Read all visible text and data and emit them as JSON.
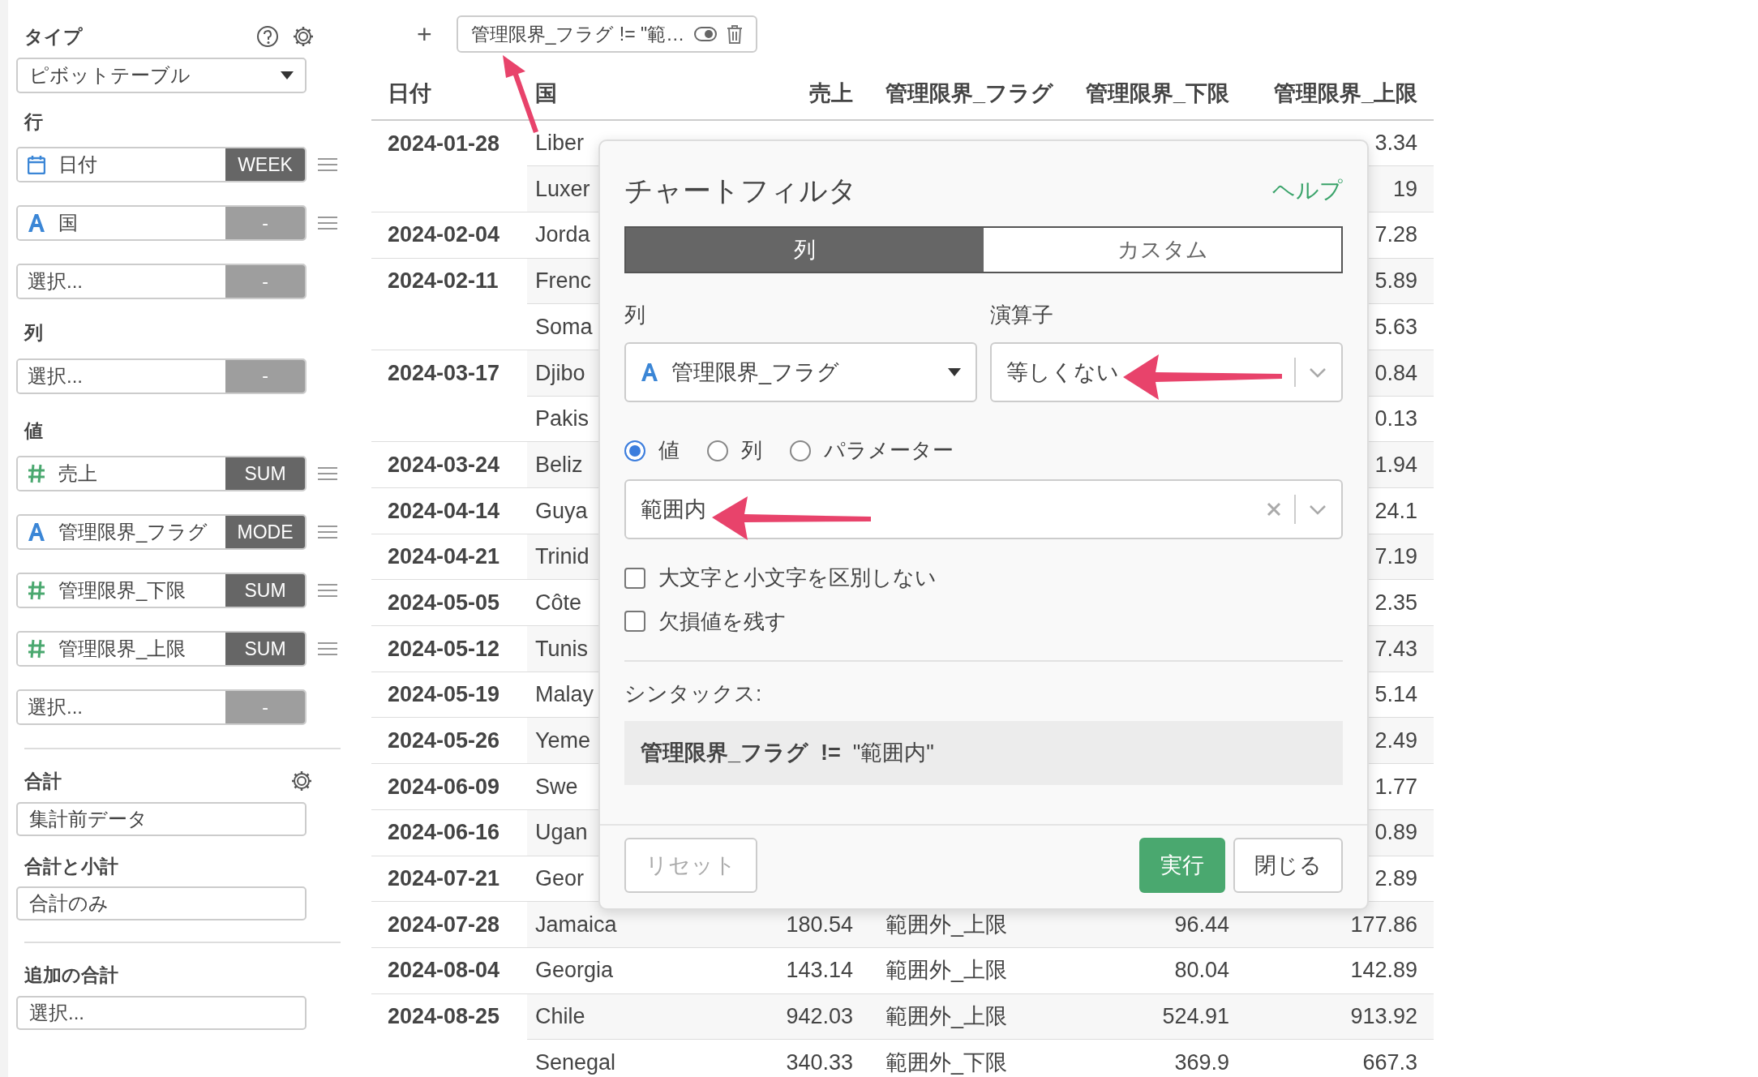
{
  "sidebar": {
    "type_label": "タイプ",
    "type_select": "ピボットテーブル",
    "sections": [
      {
        "label": "行",
        "fields": [
          {
            "kind": "date",
            "name": "日付",
            "agg": "WEEK",
            "agg_set": true,
            "draggable": true
          },
          {
            "kind": "text",
            "name": "国",
            "agg": "-",
            "agg_set": false,
            "draggable": true
          },
          {
            "kind": "empty",
            "placeholder": "選択...",
            "agg": "-",
            "agg_set": false,
            "draggable": false
          }
        ]
      },
      {
        "label": "列",
        "fields": [
          {
            "kind": "empty",
            "placeholder": "選択...",
            "agg": "-",
            "agg_set": false,
            "draggable": false
          }
        ]
      },
      {
        "label": "値",
        "fields": [
          {
            "kind": "number",
            "name": "売上",
            "agg": "SUM",
            "agg_set": true,
            "draggable": true
          },
          {
            "kind": "text",
            "name": "管理限界_フラグ",
            "agg": "MODE",
            "agg_set": true,
            "draggable": true
          },
          {
            "kind": "number",
            "name": "管理限界_下限",
            "agg": "SUM",
            "agg_set": true,
            "draggable": true
          },
          {
            "kind": "number",
            "name": "管理限界_上限",
            "agg": "SUM",
            "agg_set": true,
            "draggable": true
          },
          {
            "kind": "empty",
            "placeholder": "選択...",
            "agg": "-",
            "agg_set": false,
            "draggable": false
          }
        ]
      }
    ],
    "total": {
      "label": "合計",
      "value": "集計前データ"
    },
    "subtotal": {
      "label": "合計と小計",
      "value": "合計のみ"
    },
    "extra": {
      "label": "追加の合計",
      "placeholder": "選択..."
    }
  },
  "add_filter": "+",
  "filter_chip": {
    "text": "管理限界_フラグ != \"範…",
    "enabled": true
  },
  "table": {
    "columns": [
      "日付",
      "国",
      "売上",
      "管理限界_フラグ",
      "管理限界_下限",
      "管理限界_上限"
    ],
    "rows": [
      {
        "date": "2024-01-28",
        "country": "Liber",
        "upper": "3.34"
      },
      {
        "country": "Luxer",
        "upper": "19"
      },
      {
        "date": "2024-02-04",
        "country": "Jorda",
        "upper": "7.28"
      },
      {
        "date": "2024-02-11",
        "country": "Frenc",
        "upper": "5.89"
      },
      {
        "country": "Soma",
        "upper": "5.63"
      },
      {
        "date": "2024-03-17",
        "country": "Djibo",
        "upper": "0.84"
      },
      {
        "country": "Pakis",
        "upper": "0.13"
      },
      {
        "date": "2024-03-24",
        "country": "Beliz",
        "upper": "1.94"
      },
      {
        "date": "2024-04-14",
        "country": "Guya",
        "upper": "24.1"
      },
      {
        "date": "2024-04-21",
        "country": "Trinid",
        "upper": "7.19"
      },
      {
        "date": "2024-05-05",
        "country": "Côte",
        "upper": "2.35"
      },
      {
        "date": "2024-05-12",
        "country": "Tunis",
        "upper": "7.43"
      },
      {
        "date": "2024-05-19",
        "country": "Malay",
        "upper": "5.14"
      },
      {
        "date": "2024-05-26",
        "country": "Yeme",
        "upper": "2.49"
      },
      {
        "date": "2024-06-09",
        "country": "Swe",
        "upper": "1.77"
      },
      {
        "date": "2024-06-16",
        "country": "Ugan",
        "upper": "0.89"
      },
      {
        "date": "2024-07-21",
        "country": "Geor",
        "upper": "2.89"
      },
      {
        "date": "2024-07-28",
        "country": "Jamaica",
        "sales": "180.54",
        "flag": "範囲外_上限",
        "lower": "96.44",
        "upper": "177.86"
      },
      {
        "date": "2024-08-04",
        "country": "Georgia",
        "sales": "143.14",
        "flag": "範囲外_上限",
        "lower": "80.04",
        "upper": "142.89"
      },
      {
        "date": "2024-08-25",
        "country": "Chile",
        "sales": "942.03",
        "flag": "範囲外_上限",
        "lower": "524.91",
        "upper": "913.92"
      },
      {
        "country": "Senegal",
        "sales": "340.33",
        "flag": "範囲外_下限",
        "lower": "369.9",
        "upper": "667.3"
      }
    ]
  },
  "dialog": {
    "title": "チャートフィルタ",
    "help": "ヘルプ",
    "tabs": [
      {
        "label": "列",
        "selected": true
      },
      {
        "label": "カスタム",
        "selected": false
      }
    ],
    "column_label": "列",
    "operator_label": "演算子",
    "column_select": {
      "kind": "text",
      "value": "管理限界_フラグ"
    },
    "operator_select": "等しくない",
    "value_modes": [
      {
        "label": "値",
        "selected": true
      },
      {
        "label": "列",
        "selected": false
      },
      {
        "label": "パラメーター",
        "selected": false
      }
    ],
    "value_select": "範囲内",
    "options": [
      {
        "label": "大文字と小文字を区別しない",
        "checked": false
      },
      {
        "label": "欠損値を残す",
        "checked": false
      }
    ],
    "syntax_label": "シンタックス:",
    "syntax": "**管理限界_フラグ  !=**  \"範囲内\"",
    "buttons": {
      "reset": "リセット",
      "run": "実行",
      "close": "閉じる"
    }
  }
}
